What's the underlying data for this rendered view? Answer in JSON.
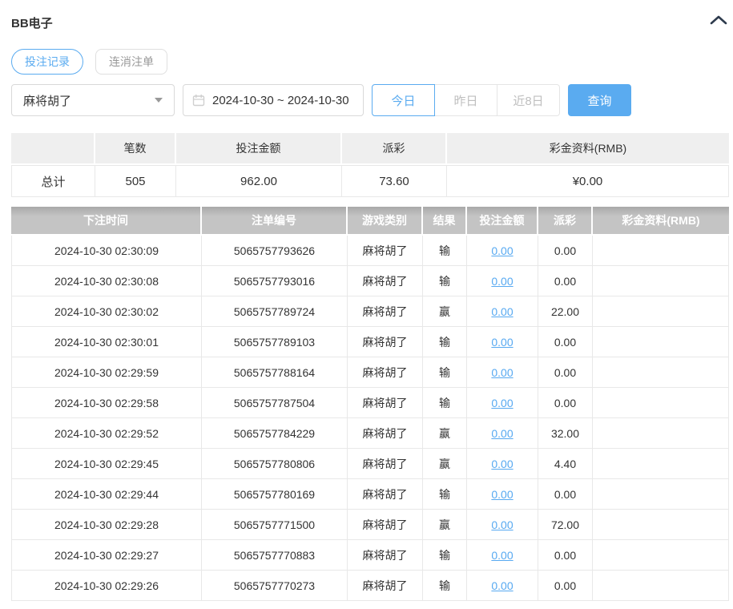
{
  "colors": {
    "accent": "#5aabf0",
    "link": "#57a9f1",
    "summary_header_bg": "#efefef",
    "detail_header_bg": "#c4c4c4",
    "table_border": "#e8e8e8",
    "text": "#333333"
  },
  "header": {
    "title": "BB电子",
    "collapse_icon": "chevron-up"
  },
  "tabs": [
    {
      "label": "投注记录",
      "active": true
    },
    {
      "label": "连消注单",
      "active": false
    }
  ],
  "filters": {
    "game_select": {
      "value": "麻将胡了",
      "icon": "caret-down"
    },
    "date_range": {
      "value": "2024-10-30 ~ 2024-10-30",
      "icon": "calendar"
    },
    "quick_ranges": [
      {
        "label": "今日",
        "active": true
      },
      {
        "label": "昨日",
        "active": false
      },
      {
        "label": "近8日",
        "active": false
      }
    ],
    "query_label": "查询"
  },
  "summary_table": {
    "headers": [
      "",
      "笔数",
      "投注金额",
      "派彩",
      "彩金资料(RMB)"
    ],
    "row": {
      "label": "总计",
      "count": "505",
      "bet_amount": "962.00",
      "payout": "73.60",
      "jackpot": "¥0.00"
    }
  },
  "detail_table": {
    "headers": [
      "下注时间",
      "注单编号",
      "游戏类别",
      "结果",
      "投注金额",
      "派彩",
      "彩金资料(RMB)"
    ],
    "rows": [
      {
        "time": "2024-10-30 02:30:09",
        "order_no": "5065757793626",
        "game": "麻将胡了",
        "result": "输",
        "bet": "0.00",
        "payout": "0.00",
        "jackpot": ""
      },
      {
        "time": "2024-10-30 02:30:08",
        "order_no": "5065757793016",
        "game": "麻将胡了",
        "result": "输",
        "bet": "0.00",
        "payout": "0.00",
        "jackpot": ""
      },
      {
        "time": "2024-10-30 02:30:02",
        "order_no": "5065757789724",
        "game": "麻将胡了",
        "result": "赢",
        "bet": "0.00",
        "payout": "22.00",
        "jackpot": ""
      },
      {
        "time": "2024-10-30 02:30:01",
        "order_no": "5065757789103",
        "game": "麻将胡了",
        "result": "输",
        "bet": "0.00",
        "payout": "0.00",
        "jackpot": ""
      },
      {
        "time": "2024-10-30 02:29:59",
        "order_no": "5065757788164",
        "game": "麻将胡了",
        "result": "输",
        "bet": "0.00",
        "payout": "0.00",
        "jackpot": ""
      },
      {
        "time": "2024-10-30 02:29:58",
        "order_no": "5065757787504",
        "game": "麻将胡了",
        "result": "输",
        "bet": "0.00",
        "payout": "0.00",
        "jackpot": ""
      },
      {
        "time": "2024-10-30 02:29:52",
        "order_no": "5065757784229",
        "game": "麻将胡了",
        "result": "赢",
        "bet": "0.00",
        "payout": "32.00",
        "jackpot": ""
      },
      {
        "time": "2024-10-30 02:29:45",
        "order_no": "5065757780806",
        "game": "麻将胡了",
        "result": "赢",
        "bet": "0.00",
        "payout": "4.40",
        "jackpot": ""
      },
      {
        "time": "2024-10-30 02:29:44",
        "order_no": "5065757780169",
        "game": "麻将胡了",
        "result": "输",
        "bet": "0.00",
        "payout": "0.00",
        "jackpot": ""
      },
      {
        "time": "2024-10-30 02:29:28",
        "order_no": "5065757771500",
        "game": "麻将胡了",
        "result": "赢",
        "bet": "0.00",
        "payout": "72.00",
        "jackpot": ""
      },
      {
        "time": "2024-10-30 02:29:27",
        "order_no": "5065757770883",
        "game": "麻将胡了",
        "result": "输",
        "bet": "0.00",
        "payout": "0.00",
        "jackpot": ""
      },
      {
        "time": "2024-10-30 02:29:26",
        "order_no": "5065757770273",
        "game": "麻将胡了",
        "result": "输",
        "bet": "0.00",
        "payout": "0.00",
        "jackpot": ""
      }
    ]
  }
}
